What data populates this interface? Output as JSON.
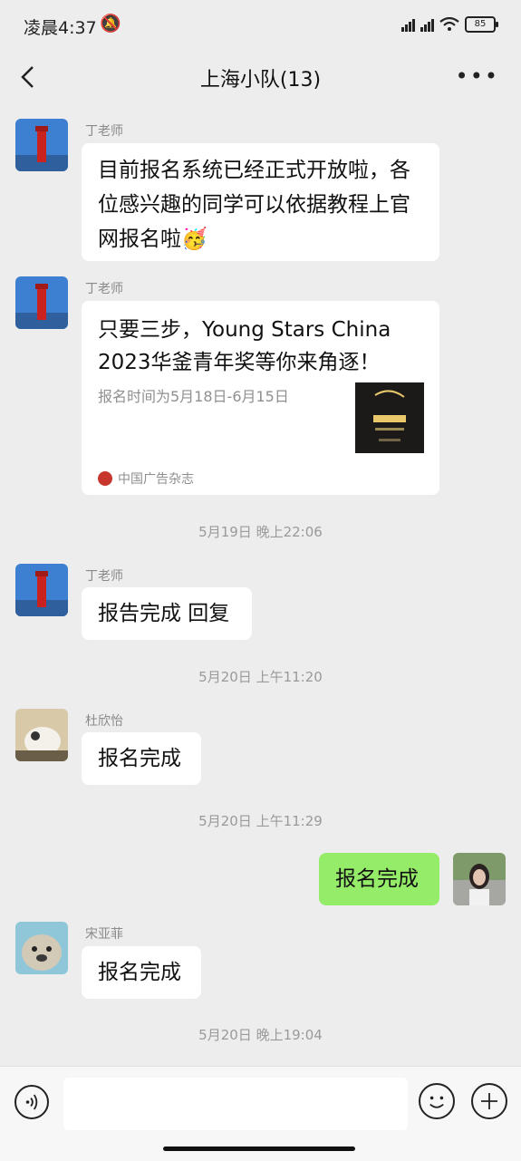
{
  "status_bar": {
    "time": "凌晨4:37",
    "mute_icon": "bell-off-icon",
    "battery": "85",
    "colors": {
      "text": "#222222"
    }
  },
  "header": {
    "title": "上海小队(13)",
    "back_icon": "chevron-left-icon",
    "more_icon": "more-horizontal-icon"
  },
  "messages": [
    {
      "sender": "丁老师",
      "text_lines": [
        "目前报名系统已经正式开放啦，各",
        "位感兴趣的同学可以依据教程上官",
        "网报名啦"
      ],
      "emoji": "party-face-emoji"
    },
    {
      "sender": "丁老师",
      "card": {
        "title_lines": [
          "只要三步，Young Stars China",
          "2023华釜青年奖等你来角逐！"
        ],
        "desc": "报名时间为5月18日-6月15日",
        "source": "中国广告杂志"
      }
    },
    {
      "timestamp": "5月19日 晚上22:06"
    },
    {
      "sender": "丁老师",
      "text": "报告完成 回复"
    },
    {
      "timestamp": "5月20日 上午11:20"
    },
    {
      "sender": "杜欣怡",
      "text": "报名完成"
    },
    {
      "timestamp": "5月20日 上午11:29"
    },
    {
      "self": true,
      "text": "报名完成"
    },
    {
      "sender": "宋亚菲",
      "text": "报名完成"
    },
    {
      "timestamp": "5月20日 晚上19:04"
    }
  ],
  "input_bar": {
    "voice_icon": "voice-icon",
    "emoji_icon": "smile-icon",
    "plus_icon": "plus-circle-icon",
    "placeholder": ""
  },
  "colors": {
    "background": "#ededed",
    "bubble_self": "#95ec69",
    "bubble_other": "#ffffff"
  }
}
